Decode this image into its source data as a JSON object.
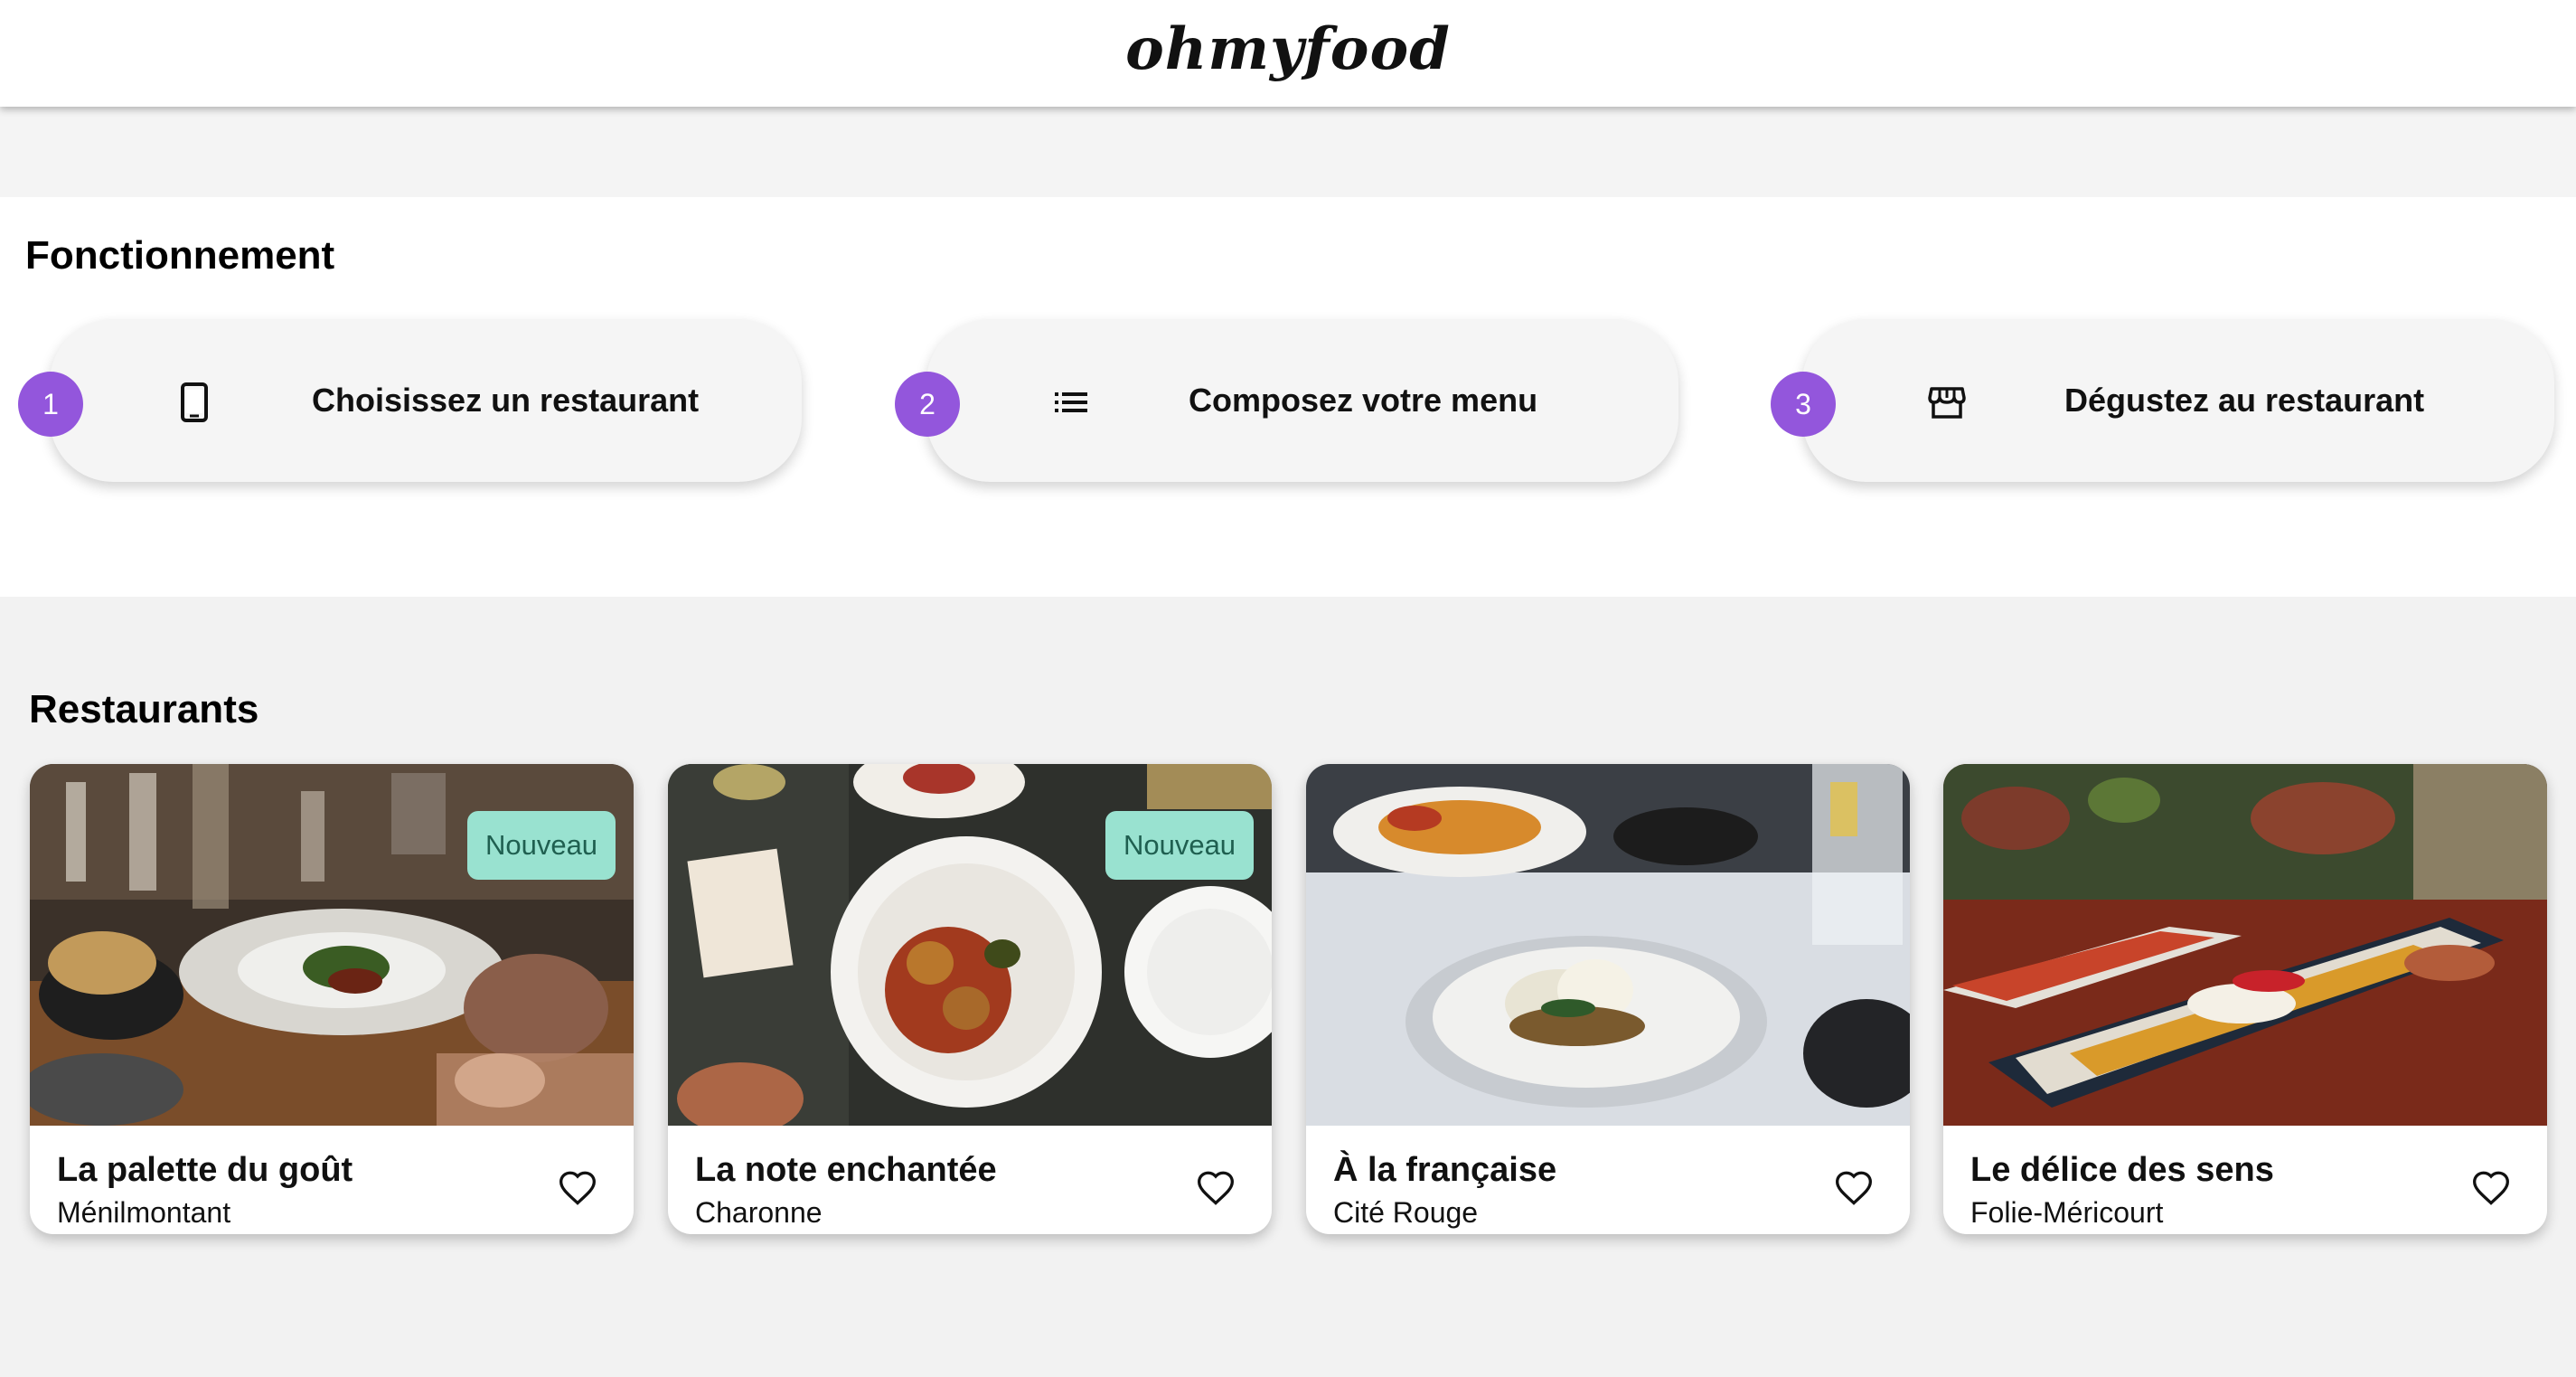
{
  "header": {
    "logo": "ohmyfood"
  },
  "how_it_works": {
    "title": "Fonctionnement",
    "steps": [
      {
        "number": "1",
        "icon": "smartphone-icon",
        "label": "Choisissez un restaurant"
      },
      {
        "number": "2",
        "icon": "list-icon",
        "label": "Composez votre menu"
      },
      {
        "number": "3",
        "icon": "storefront-icon",
        "label": "Dégustez au restaurant"
      }
    ]
  },
  "restaurants": {
    "title": "Restaurants",
    "items": [
      {
        "name": "La palette du goût",
        "area": "Ménilmontant",
        "badge": "Nouveau",
        "favorite_icon": "heart-outline-icon"
      },
      {
        "name": "La note enchantée",
        "area": "Charonne",
        "badge": "Nouveau",
        "favorite_icon": "heart-outline-icon"
      },
      {
        "name": "À la française",
        "area": "Cité Rouge",
        "badge": "",
        "favorite_icon": "heart-outline-icon"
      },
      {
        "name": "Le délice des sens",
        "area": "Folie-Méricourt",
        "badge": "",
        "favorite_icon": "heart-outline-icon"
      }
    ]
  },
  "colors": {
    "accent_purple": "#9356dc",
    "badge_mint": "#99e2d0",
    "page_bg": "#f5f5f5"
  }
}
